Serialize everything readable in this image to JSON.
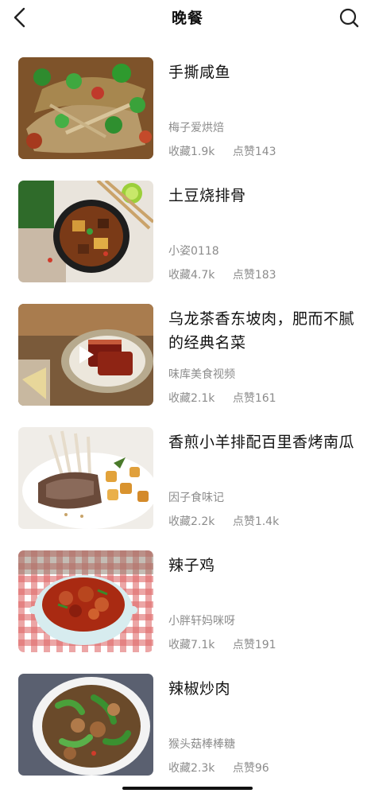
{
  "header": {
    "title": "晚餐",
    "back_icon": "chevron-left-icon",
    "search_icon": "search-icon"
  },
  "recipes": [
    {
      "title": "手撕咸鱼",
      "author": "梅子爱烘焙",
      "favorites": "收藏1.9k",
      "likes": "点赞143",
      "has_video": false
    },
    {
      "title": "土豆烧排骨",
      "author": "小姿0118",
      "favorites": "收藏4.7k",
      "likes": "点赞183",
      "has_video": false
    },
    {
      "title": "乌龙茶香东坡肉，肥而不腻的经典名菜",
      "author": "味库美食视频",
      "favorites": "收藏2.1k",
      "likes": "点赞161",
      "has_video": true
    },
    {
      "title": "香煎小羊排配百里香烤南瓜",
      "author": "因子食味记",
      "favorites": "收藏2.2k",
      "likes": "点赞1.4k",
      "has_video": false
    },
    {
      "title": "辣子鸡",
      "author": "小胖轩妈咪呀",
      "favorites": "收藏7.1k",
      "likes": "点赞191",
      "has_video": false
    },
    {
      "title": "辣椒炒肉",
      "author": "猴头菇棒棒糖",
      "favorites": "收藏2.3k",
      "likes": "点赞96",
      "has_video": false
    }
  ]
}
